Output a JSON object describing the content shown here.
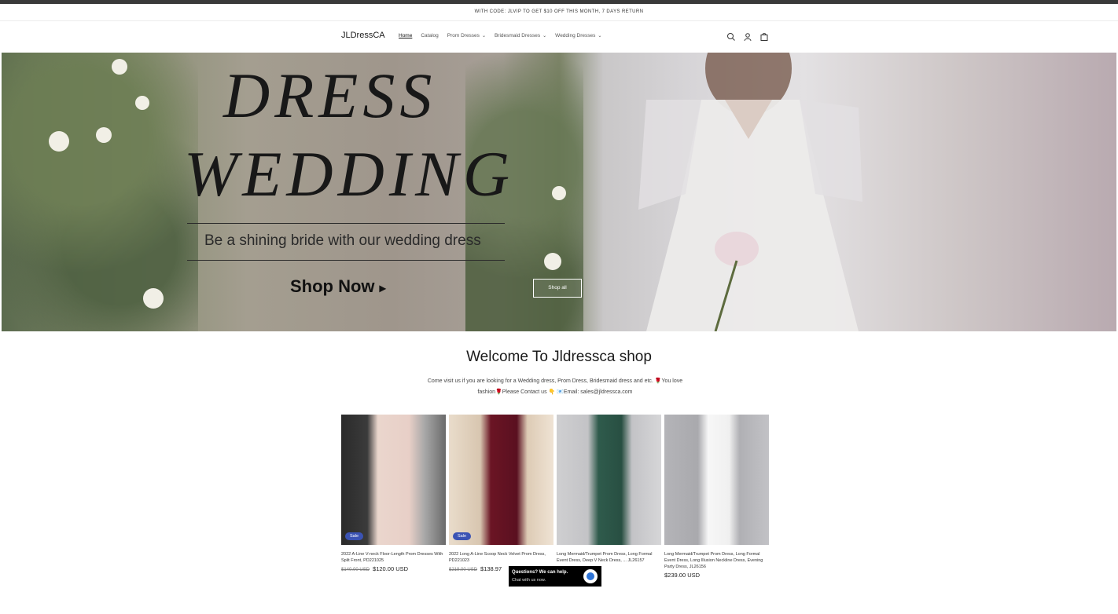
{
  "announcement": "WITH CODE: JLVIP TO GET $10 OFF THIS MONTH, 7 DAYS RETURN",
  "header": {
    "logo": "JLDressCA",
    "nav": [
      {
        "label": "Home",
        "active": true,
        "dropdown": false
      },
      {
        "label": "Catalog",
        "active": false,
        "dropdown": false
      },
      {
        "label": "Prom Dresses",
        "active": false,
        "dropdown": true
      },
      {
        "label": "Bridesmaid Dresses",
        "active": false,
        "dropdown": true
      },
      {
        "label": "Wedding Dresses",
        "active": false,
        "dropdown": true
      }
    ],
    "icons": [
      "search-icon",
      "account-icon",
      "cart-icon"
    ]
  },
  "hero": {
    "title_line1": "DRESS",
    "title_line2": "WEDDING",
    "subtitle": "Be a shining bride with our wedding dress",
    "cta_text": "Shop Now",
    "cta_arrow": "▸",
    "button": "Shop all"
  },
  "welcome": {
    "title": "Welcome To Jldressca shop",
    "line1": "Come visit us if you are looking for a Wedding dress, Prom Dress, Bridesmaid dress and etc. 🌹You love",
    "line2": "fashion🌹Please Contact us 👇 📧Email: sales@jldressca.com"
  },
  "products": [
    {
      "title": "2022 A-Line V-neck Floor-Length Prom Dresses With Split Front, PD221025",
      "old_price": "$140.00 USD",
      "price": "$120.00 USD",
      "sale": "Sale",
      "color": "#e8cfc7"
    },
    {
      "title": "2022 Long A-Line Scoop Neck Velvet Prom Dress, PD221023",
      "old_price": "$219.00 USD",
      "price": "$138.97",
      "sale": "Sale",
      "color": "#6b1524"
    },
    {
      "title": "Long Mermaid/Trumpet Prom Dress, Long Formal Event Dress, Deep V Neck Dress, ... JL26157",
      "old_price": "",
      "price": "",
      "sale": "",
      "color": "#2f5b4c"
    },
    {
      "title": "Long Mermaid/Trumpet Prom Dress, Long Formal Event Dress, Long Illusion Neckline Dress, Evening Party Dress, JL26156",
      "old_price": "",
      "price": "$239.00 USD",
      "sale": "",
      "color": "#f4f4f4"
    }
  ],
  "chat": {
    "line1": "Questions? We can help.",
    "line2": "Chat with us now."
  }
}
